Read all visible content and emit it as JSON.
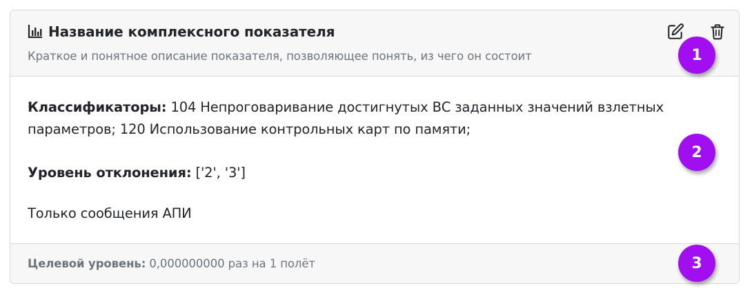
{
  "header": {
    "icon": "bar-chart-icon",
    "title": "Название комплексного показателя",
    "subtitle": "Краткое и понятное описание показателя, позволяющее понять, из чего он состоит",
    "actions": {
      "edit_icon": "edit-icon",
      "delete_icon": "trash-icon"
    }
  },
  "body": {
    "classifiers_label": "Классификаторы:",
    "classifiers_value": " 104 Непроговаривание достигнутых ВС заданных значений взлетных параметров; 120 Использование контрольных карт по памяти;",
    "deviation_label": "Уровень отклонения:",
    "deviation_value": " ['2', '3']",
    "api_only": "Только сообщения АПИ"
  },
  "footer": {
    "target_label": "Целевой уровень:",
    "target_value": " 0,000000000 раз на 1 полёт"
  },
  "badges": [
    "1",
    "2",
    "3"
  ],
  "colors": {
    "badge": "#a10ff0",
    "header_bg": "#f7f7f7",
    "muted_text": "#6c757d",
    "text": "#212529"
  }
}
